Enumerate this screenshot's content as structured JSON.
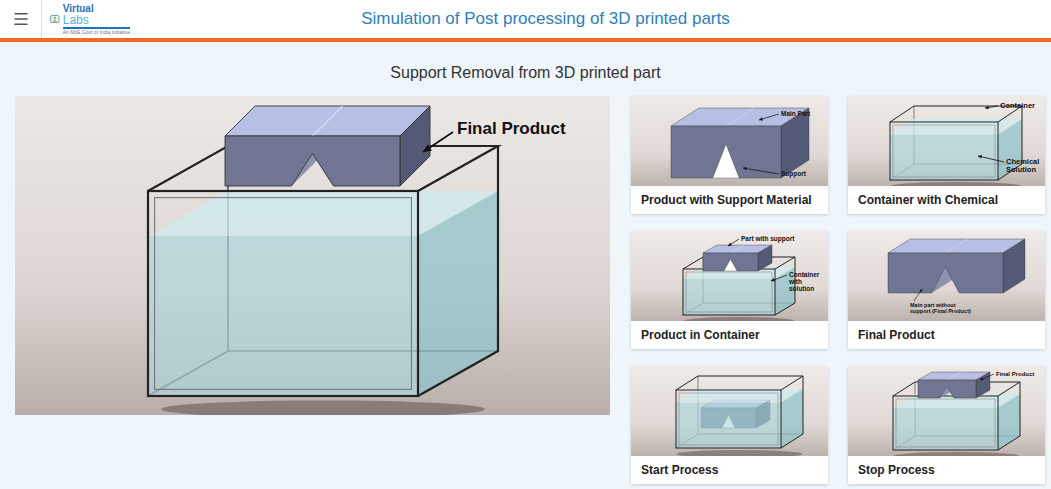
{
  "header": {
    "logo": {
      "line1": "Virtual",
      "line2": "Labs",
      "tagline": "An MoE Govt of India Initiative"
    },
    "title": "Simulation of Post processing of 3D printed parts"
  },
  "section_title": "Support Removal from 3D printed part",
  "main_image": {
    "kind": "main",
    "labels": [
      {
        "lines": [
          "Final Product"
        ]
      }
    ]
  },
  "thumbnails": [
    {
      "caption": "Product with Support Material",
      "kind": "part-support",
      "labels": [
        {
          "lines": [
            "Main Part"
          ]
        },
        {
          "lines": [
            "Support"
          ]
        }
      ]
    },
    {
      "caption": "Container with Chemical",
      "kind": "container",
      "labels": [
        {
          "lines": [
            "Container"
          ]
        },
        {
          "lines": [
            "Chemical",
            "Solution"
          ]
        }
      ]
    },
    {
      "caption": "Product in Container",
      "kind": "part-in-container",
      "labels": [
        {
          "lines": [
            "Part with support"
          ]
        },
        {
          "lines": [
            "Container",
            "with",
            "solution"
          ]
        }
      ]
    },
    {
      "caption": "Final Product",
      "kind": "final",
      "labels": [
        {
          "lines": [
            "Main part without",
            "support (Final Product)"
          ]
        }
      ]
    },
    {
      "caption": "Start Process",
      "kind": "start",
      "labels": []
    },
    {
      "caption": "Stop Process",
      "kind": "stop",
      "labels": [
        {
          "lines": [
            "Final Product"
          ]
        }
      ]
    }
  ]
}
